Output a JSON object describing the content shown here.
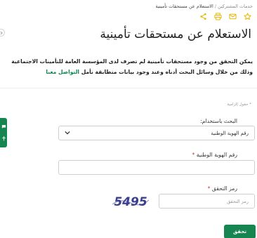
{
  "breadcrumb": {
    "parent": "خدمات المشتركين",
    "separator": "/",
    "current": "الاستعلام عن مستحقات تأمينية"
  },
  "actions": [
    {
      "name": "star-icon"
    },
    {
      "name": "mail-icon"
    },
    {
      "name": "printer-icon"
    },
    {
      "name": "share-icon"
    }
  ],
  "page": {
    "title": "الاستعلام عن مستحقات تأمينية",
    "intro_text": "يمكن التحقق من وجود مستحقات تأمينية لم تصرف لدى المؤسسة العامة للتأمينات الاجتماعية وذلك من خلال وسائل البحث أدناه وعند وجود بيانات متطابقة نأمل",
    "intro_link": "التواصل معنا",
    "required_note": "* حقول إلزامية"
  },
  "form": {
    "search_by_label": "البحث باستخدام:",
    "search_by_selected": "رقم الهوية الوطنية",
    "national_id_label": "رقم الهوية الوطنية",
    "required_star": "*",
    "captcha_label": "رمز التحقق",
    "captcha_code": "5495",
    "captcha_placeholder": "رمز التحقق",
    "submit_label": "تحقق"
  },
  "colors": {
    "brand_green": "#17854f",
    "link_green": "#0a8a4f",
    "required_red": "#c0392b",
    "action_icon_yellow": "#e6b800"
  }
}
